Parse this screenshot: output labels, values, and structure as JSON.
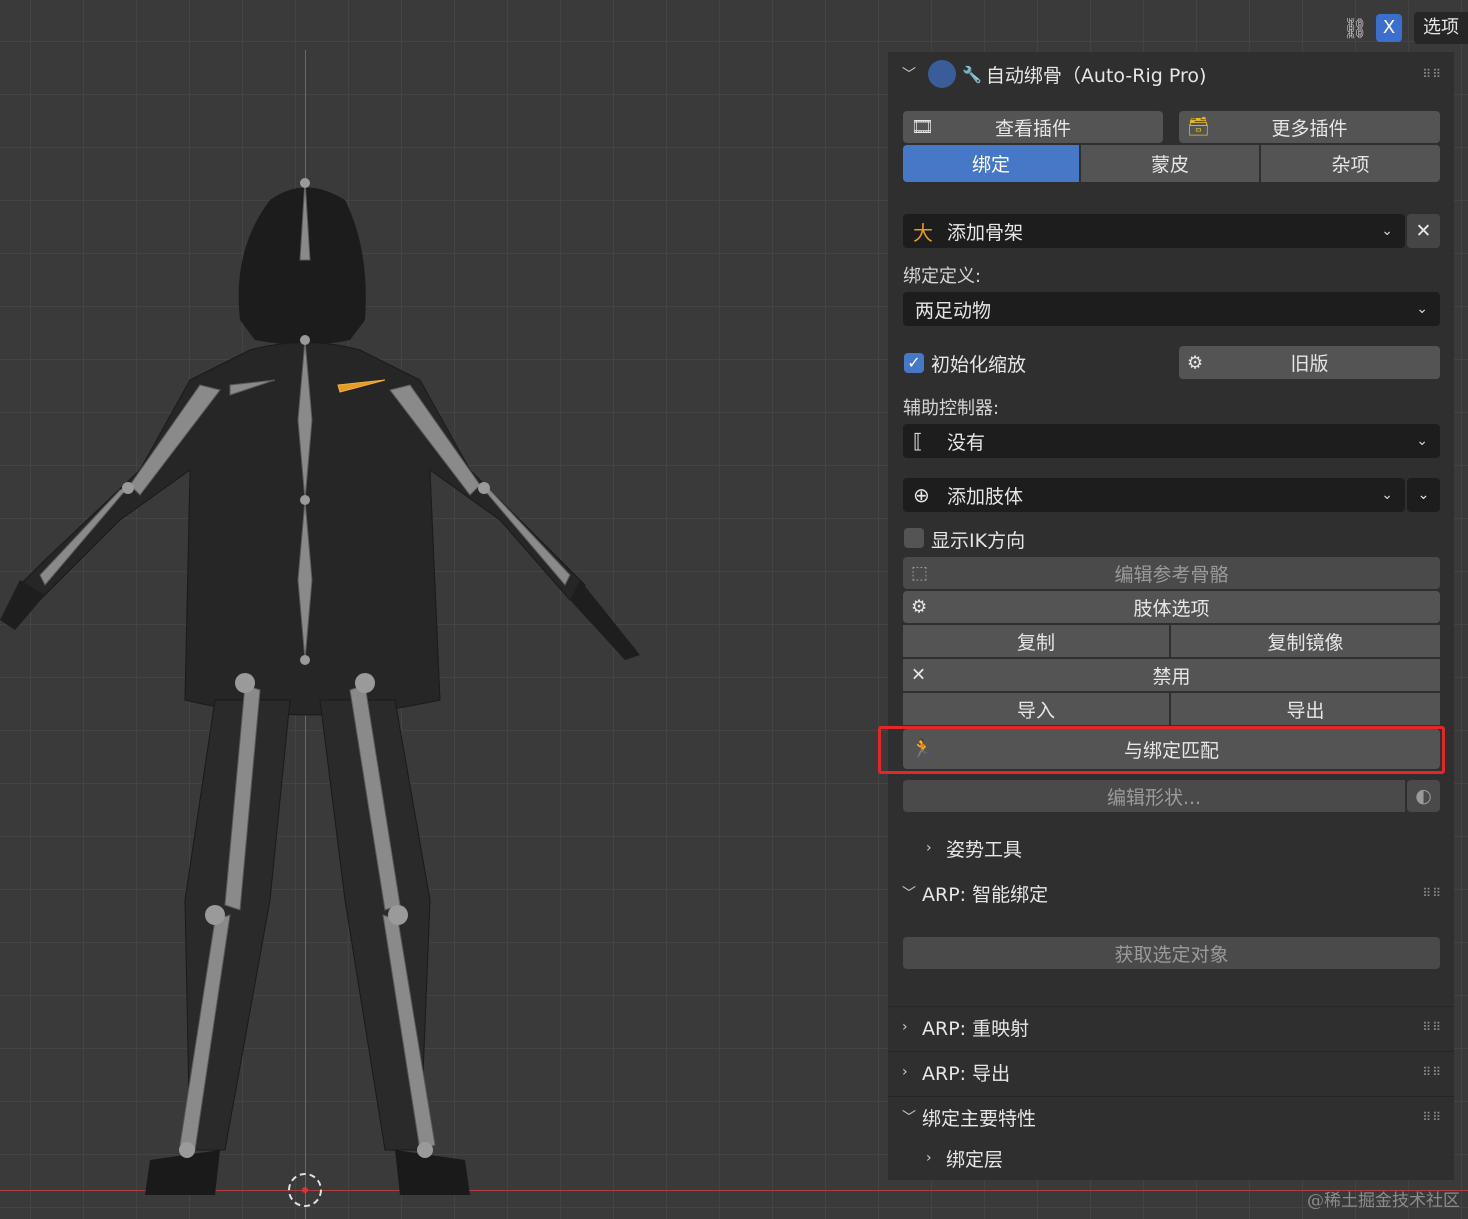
{
  "header": {
    "toggle_label": "X",
    "options_label": "选项"
  },
  "panel": {
    "title": "自动绑骨（Auto-Rig Pro)",
    "view_plugins": "查看插件",
    "more_plugins": "更多插件",
    "tabs": [
      "绑定",
      "蒙皮",
      "杂项"
    ],
    "active_tab": 0,
    "add_armature": "添加骨架",
    "rig_definition_label": "绑定定义:",
    "rig_definition_value": "两足动物",
    "init_scale_label": "初始化缩放",
    "init_scale_checked": true,
    "legacy_button": "旧版",
    "helper_controllers_label": "辅助控制器:",
    "helper_controllers_value": "没有",
    "add_limb": "添加肢体",
    "show_ik_label": "显示IK方向",
    "show_ik_checked": false,
    "edit_reference_bones": "编辑参考骨骼",
    "limb_options": "肢体选项",
    "duplicate": "复制",
    "mirror": "复制镜像",
    "disable": "禁用",
    "import": "导入",
    "export": "导出",
    "match_to_rig": "与绑定匹配",
    "edit_shape": "编辑形状...",
    "pose_tools": "姿势工具",
    "smart_rig": "ARP: 智能绑定",
    "get_selected": "获取选定对象",
    "remap": "ARP: 重映射",
    "arp_export": "ARP: 导出",
    "rig_main_props": "绑定主要特性",
    "rig_layers": "绑定层"
  },
  "watermark": "@稀土掘金技术社区"
}
